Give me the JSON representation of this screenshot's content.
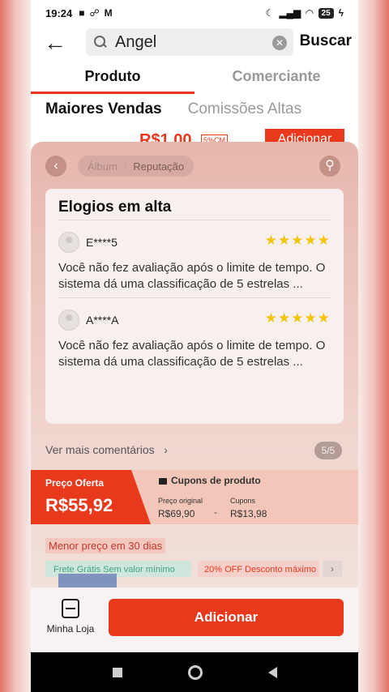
{
  "status_bar": {
    "time": "19:24",
    "battery": "25"
  },
  "search": {
    "value": "Angel",
    "submit_label": "Buscar"
  },
  "tabs": [
    {
      "label": "Produto",
      "active": true
    },
    {
      "label": "Comerciante",
      "active": false
    }
  ],
  "sort_options": [
    {
      "label": "Maiores Vendas",
      "active": true
    },
    {
      "label": "Comissões Altas",
      "active": false
    }
  ],
  "peek_item": {
    "price": "R$1,00",
    "badge": "5%CM",
    "add_label": "Adicionar"
  },
  "sheet": {
    "segment": {
      "album": "Álbum",
      "reputation": "Reputação"
    },
    "reviews_title": "Elogios em alta",
    "reviews": [
      {
        "user": "E****5",
        "stars": 5,
        "text": "Você não fez avaliação após o limite de tempo. O sistema dá uma classificação de 5 estrelas ..."
      },
      {
        "user": "A****A",
        "stars": 5,
        "text": "Você não fez avaliação após o limite de tempo. O sistema dá uma classificação de 5 estrelas ..."
      }
    ],
    "more_comments": "Ver mais comentários",
    "pager": "5/5",
    "price": {
      "offer_label": "Preço Oferta",
      "offer_value": "R$55,92",
      "coupons_title": "Cupons de produto",
      "original_label": "Preço original",
      "original_value": "R$69,90",
      "minus": "-",
      "coupons_label": "Cupons",
      "coupons_value": "R$13,98"
    },
    "lowest_price_tag": "Menor preço em 30 dias",
    "chips": [
      "Frete Grátis Sem valor mínimo",
      "20% OFF Desconto máximo"
    ]
  },
  "bottom_bar": {
    "store_label": "Minha Loja",
    "add_label": "Adicionar"
  },
  "colors": {
    "accent": "#e8391d",
    "star": "#f2c40c"
  }
}
